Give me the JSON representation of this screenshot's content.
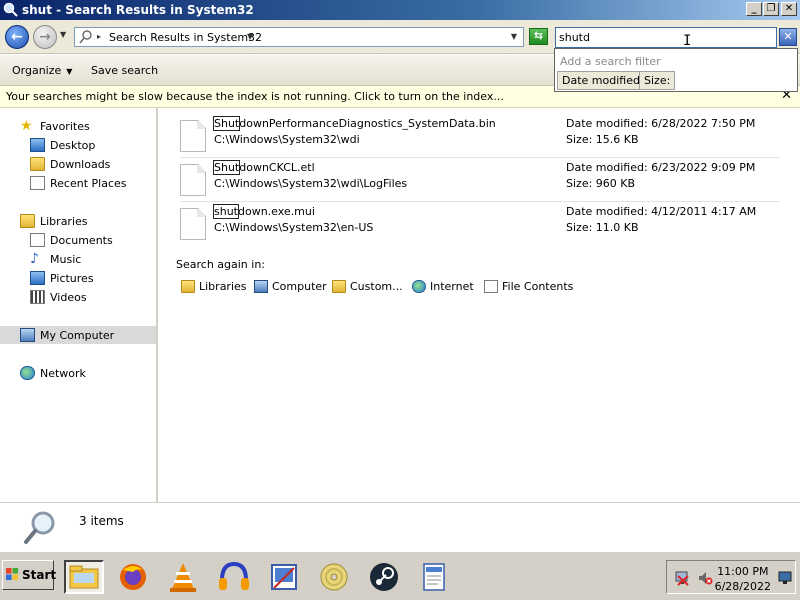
{
  "window": {
    "title": "shut - Search Results in System32"
  },
  "address": {
    "path": "Search Results in System32",
    "search_value": "shutd"
  },
  "filter": {
    "hint": "Add a search filter",
    "date_modified": "Date modified:",
    "size": "Size:"
  },
  "toolbar": {
    "organize": "Organize",
    "save_search": "Save search"
  },
  "infobar": {
    "text": "Your searches might be slow because the index is not running.  Click to turn on the index..."
  },
  "nav": {
    "favorites": "Favorites",
    "desktop": "Desktop",
    "downloads": "Downloads",
    "recent_places": "Recent Places",
    "libraries": "Libraries",
    "documents": "Documents",
    "music": "Music",
    "pictures": "Pictures",
    "videos": "Videos",
    "my_computer": "My Computer",
    "network": "Network"
  },
  "results": [
    {
      "match": "Shut",
      "rest": "downPerformanceDiagnostics_SystemData.bin",
      "path": "C:\\Windows\\System32\\wdi",
      "date": "Date modified: 6/28/2022 7:50 PM",
      "size": "Size: 15.6 KB"
    },
    {
      "match": "Shut",
      "rest": "downCKCL.etl",
      "path": "C:\\Windows\\System32\\wdi\\LogFiles",
      "date": "Date modified: 6/23/2022 9:09 PM",
      "size": "Size: 960 KB"
    },
    {
      "match": "shut",
      "rest": "down.exe.mui",
      "path": "C:\\Windows\\System32\\en-US",
      "date": "Date modified: 4/12/2011 4:17 AM",
      "size": "Size: 11.0 KB"
    }
  ],
  "search_again": {
    "label": "Search again in:",
    "libraries": "Libraries",
    "computer": "Computer",
    "custom": "Custom...",
    "internet": "Internet",
    "file_contents": "File Contents"
  },
  "details": {
    "count": "3 items"
  },
  "taskbar": {
    "start": "Start",
    "time": "11:00 PM",
    "date": "6/28/2022"
  },
  "colors": {
    "title_gradient_start": "#0a246a",
    "infobar_bg": "#ffffe1",
    "selection_bg": "#d9d9d9"
  }
}
